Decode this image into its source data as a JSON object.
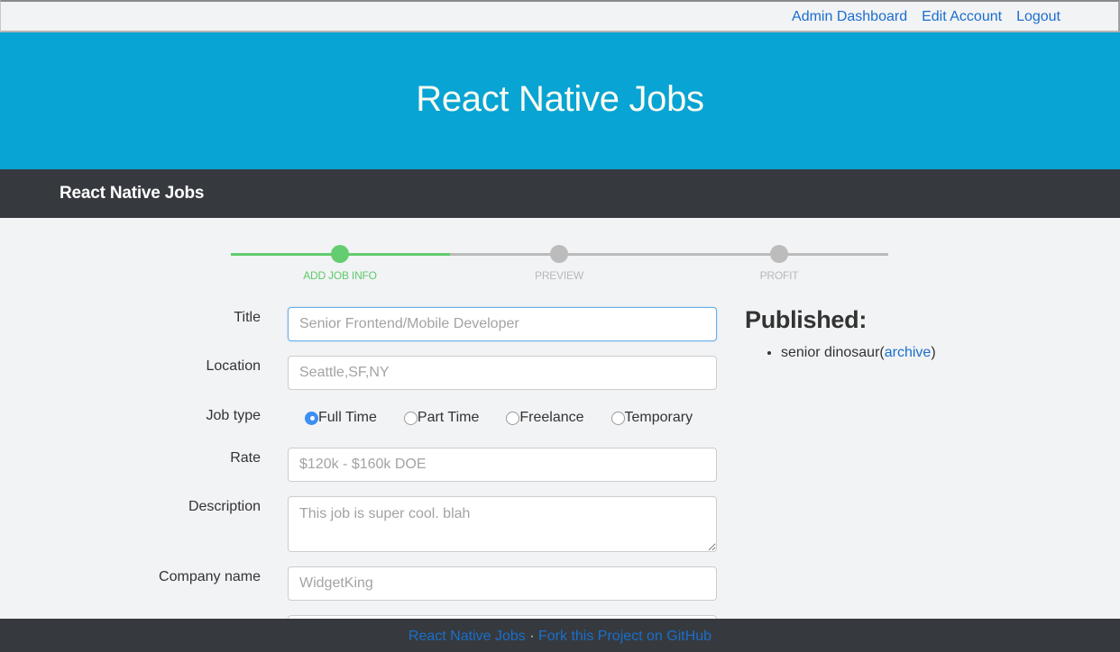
{
  "topbar": {
    "links": [
      "Admin Dashboard",
      "Edit Account",
      "Logout"
    ]
  },
  "hero": {
    "title": "React Native Jobs"
  },
  "navbar": {
    "brand": "React Native Jobs"
  },
  "stepper": {
    "current_step": 1,
    "total_steps": 3,
    "steps": [
      {
        "label": "ADD JOB INFO",
        "state": "active"
      },
      {
        "label": "PREVIEW",
        "state": "pending"
      },
      {
        "label": "PROFIT",
        "state": "pending"
      }
    ]
  },
  "form": {
    "title": {
      "label": "Title",
      "value": "",
      "placeholder": "Senior Frontend/Mobile Developer"
    },
    "location": {
      "label": "Location",
      "value": "",
      "placeholder": "Seattle,SF,NY"
    },
    "job_type": {
      "label": "Job type",
      "options": [
        "Full Time",
        "Part Time",
        "Freelance",
        "Temporary"
      ],
      "selected": "Full Time"
    },
    "rate": {
      "label": "Rate",
      "value": "",
      "placeholder": "$120k - $160k DOE"
    },
    "description": {
      "label": "Description",
      "value": "",
      "placeholder": "This job is super cool. blah"
    },
    "company_name": {
      "label": "Company name",
      "value": "",
      "placeholder": "WidgetKing"
    }
  },
  "published": {
    "heading": "Published:",
    "items": [
      {
        "name": "senior dinosaur",
        "action": "archive"
      }
    ]
  },
  "footer": {
    "home_link": "React Native Jobs",
    "separator": "·",
    "github_link": "Fork this Project on GitHub"
  },
  "colors": {
    "hero_bg": "#07a4d4",
    "navbar_bg": "#363a3e",
    "page_bg": "#f2f3f5",
    "link": "#1a6ecb",
    "step_active": "#65cd71",
    "step_pending": "#bcbcbc"
  }
}
